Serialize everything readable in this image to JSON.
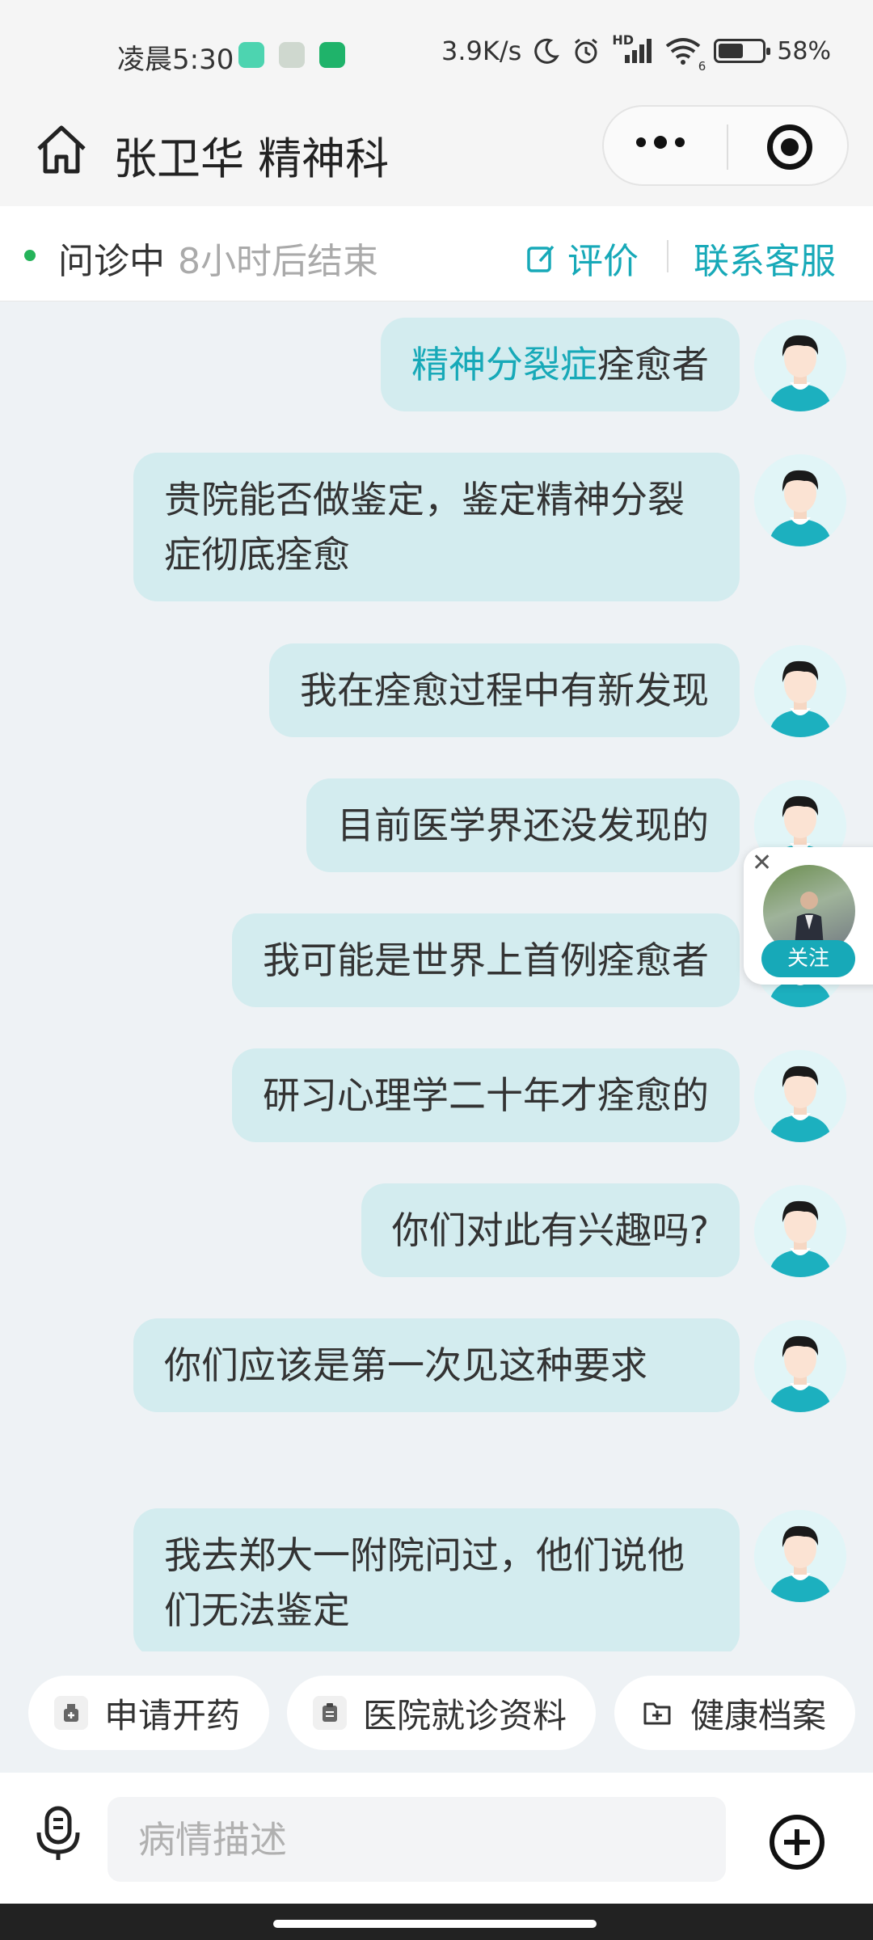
{
  "status_bar": {
    "time": "凌晨5:30",
    "net_speed": "3.9K/s",
    "signal_label": "HD",
    "wifi_label": "6",
    "battery_text": "58%",
    "battery_level": 0.58
  },
  "nav": {
    "title": "张卫华 精神科",
    "more_icon": "more-dots-icon",
    "target_icon": "target-icon"
  },
  "consult": {
    "status": "问诊中",
    "time_left": "8小时后结束",
    "evaluate_label": "评价",
    "service_label": "联系客服"
  },
  "messages": [
    {
      "highlight": "精神分裂症",
      "text": "痊愈者"
    },
    {
      "highlight": "",
      "text": "贵院能否做鉴定，鉴定精神分裂症彻底痊愈"
    },
    {
      "highlight": "",
      "text": "我在痊愈过程中有新发现"
    },
    {
      "highlight": "",
      "text": "目前医学界还没发现的"
    },
    {
      "highlight": "",
      "text": "我可能是世界上首例痊愈者"
    },
    {
      "highlight": "",
      "text": "研习心理学二十年才痊愈的"
    },
    {
      "highlight": "",
      "text": "你们对此有兴趣吗?"
    },
    {
      "highlight": "",
      "text": "你们应该是第一次见这种要求"
    },
    {
      "highlight": "",
      "text": "我去郑大一附院问过，他们说他们无法鉴定"
    }
  ],
  "follow_widget": {
    "close": "✕",
    "button_label": "关注"
  },
  "actions": [
    {
      "label": "申请开药",
      "icon": "medicine-icon"
    },
    {
      "label": "医院就诊资料",
      "icon": "clipboard-icon"
    },
    {
      "label": "健康档案",
      "icon": "folder-plus-icon"
    }
  ],
  "input": {
    "placeholder": "病情描述"
  },
  "colors": {
    "accent": "#17a9b8",
    "bubble": "#d3ecef",
    "background": "#eef2f5",
    "online": "#25b35a"
  }
}
